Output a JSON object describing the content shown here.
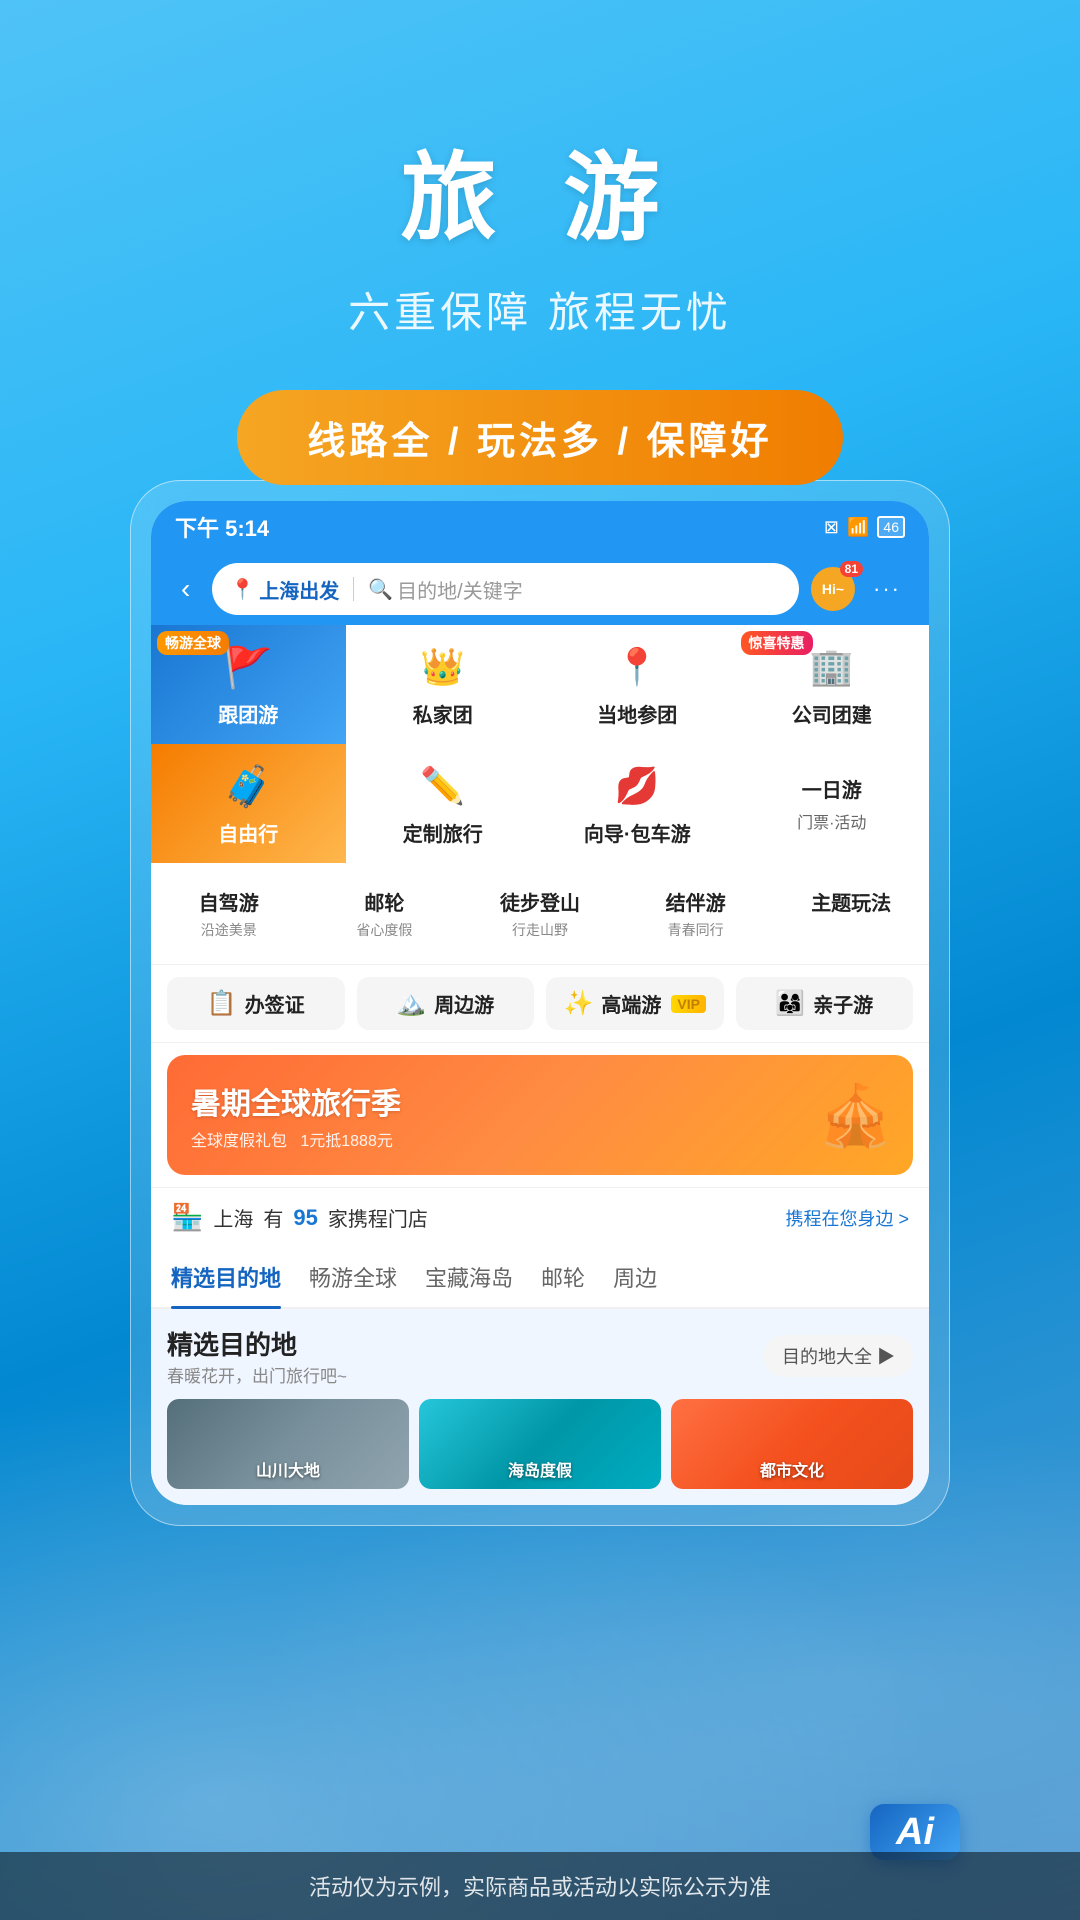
{
  "hero": {
    "title": "旅 游",
    "subtitle": "六重保障 旅程无忧",
    "badge": "线路全 / 玩法多 / 保障好"
  },
  "statusBar": {
    "time": "下午 5:14",
    "battery": "46"
  },
  "navbar": {
    "departure": "上海出发",
    "destinationPlaceholder": "目的地/关键字",
    "badge": "81",
    "hiLabel": "Hi~"
  },
  "menuGrid": {
    "row1": [
      {
        "id": "group-tour",
        "label": "跟团游",
        "tag": "畅游全球",
        "tagType": "normal",
        "bg": "blue"
      },
      {
        "id": "private-tour",
        "label": "私家团",
        "tag": "",
        "bg": "white"
      },
      {
        "id": "local-tour",
        "label": "当地参团",
        "tag": "",
        "bg": "white"
      },
      {
        "id": "company-tour",
        "label": "公司团建",
        "tag": "惊喜特惠",
        "tagType": "special",
        "bg": "white"
      }
    ],
    "row2": [
      {
        "id": "free-travel",
        "label": "自由行",
        "tag": "",
        "bg": "orange"
      },
      {
        "id": "custom-travel",
        "label": "定制旅行",
        "tag": "",
        "bg": "white"
      },
      {
        "id": "guide-car",
        "label": "向导·包车游",
        "tag": "",
        "bg": "white"
      },
      {
        "id": "day-tour",
        "label": "一日游",
        "sublabel": "门票·活动",
        "tag": "",
        "bg": "white"
      }
    ]
  },
  "textMenu": [
    {
      "id": "self-drive",
      "main": "自驾游",
      "sub": "沿途美景"
    },
    {
      "id": "cruise",
      "main": "邮轮",
      "sub": "省心度假"
    },
    {
      "id": "hiking",
      "main": "徒步登山",
      "sub": "行走山野"
    },
    {
      "id": "companion",
      "main": "结伴游",
      "sub": "青春同行"
    },
    {
      "id": "theme",
      "main": "主题玩法",
      "sub": ""
    }
  ],
  "quickCategories": [
    {
      "id": "visa",
      "label": "办签证",
      "icon": "📋"
    },
    {
      "id": "nearby",
      "label": "周边游",
      "icon": "🏔️"
    },
    {
      "id": "luxury",
      "label": "高端游",
      "tag": "VIP",
      "icon": "✨"
    },
    {
      "id": "family",
      "label": "亲子游",
      "icon": "👨‍👩‍👧"
    }
  ],
  "banner": {
    "title": "暑期全球旅行季",
    "sub": "全球度假礼包",
    "discount": "1元抵1888元"
  },
  "storeInfo": {
    "city": "上海",
    "count": "95",
    "label1": "有",
    "label2": "家携程门店",
    "linkText": "携程在您身边 >"
  },
  "tabs": [
    {
      "id": "featured",
      "label": "精选目的地",
      "active": true
    },
    {
      "id": "global",
      "label": "畅游全球",
      "active": false
    },
    {
      "id": "island",
      "label": "宝藏海岛",
      "active": false
    },
    {
      "id": "cruise-tab",
      "label": "邮轮",
      "active": false
    },
    {
      "id": "nearby-tab",
      "label": "周边",
      "active": false
    }
  ],
  "featuredSection": {
    "title": "精选目的地",
    "subtitle": "春暖花开，出门旅行吧~",
    "buttonLabel": "目的地大全 ▶",
    "destinations": [
      {
        "id": "mountain",
        "label": "山川大地",
        "type": "mountain"
      },
      {
        "id": "beach",
        "label": "海岛度假",
        "type": "beach"
      },
      {
        "id": "city",
        "label": "都市文化",
        "type": "city"
      }
    ]
  },
  "disclaimer": "活动仅为示例，实际商品或活动以实际公示为准",
  "aiBadge": "Ai"
}
